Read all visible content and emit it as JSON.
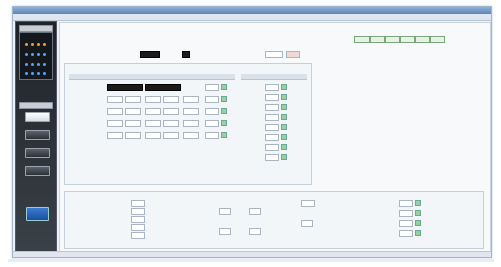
{
  "window": {
    "menu_items": [
      "",
      "",
      "",
      "",
      "",
      "",
      "",
      "",
      ""
    ]
  },
  "sidebar": {
    "buttons": [
      {
        "label": "",
        "active": true
      },
      {
        "label": "",
        "active": false
      },
      {
        "label": "",
        "active": false
      },
      {
        "label": "",
        "active": false
      }
    ]
  },
  "main": {
    "heading": "",
    "top_buttons": [
      "",
      "",
      "",
      "",
      "",
      ""
    ],
    "section_title": "",
    "bottom_title": ""
  },
  "colors": {
    "accent": "#f0a020",
    "dot_blue": "#4fa3ff",
    "sidebar_bg": "#2a3036"
  },
  "icons": [
    "star-icon",
    "dot-icon",
    "logo-icon"
  ]
}
